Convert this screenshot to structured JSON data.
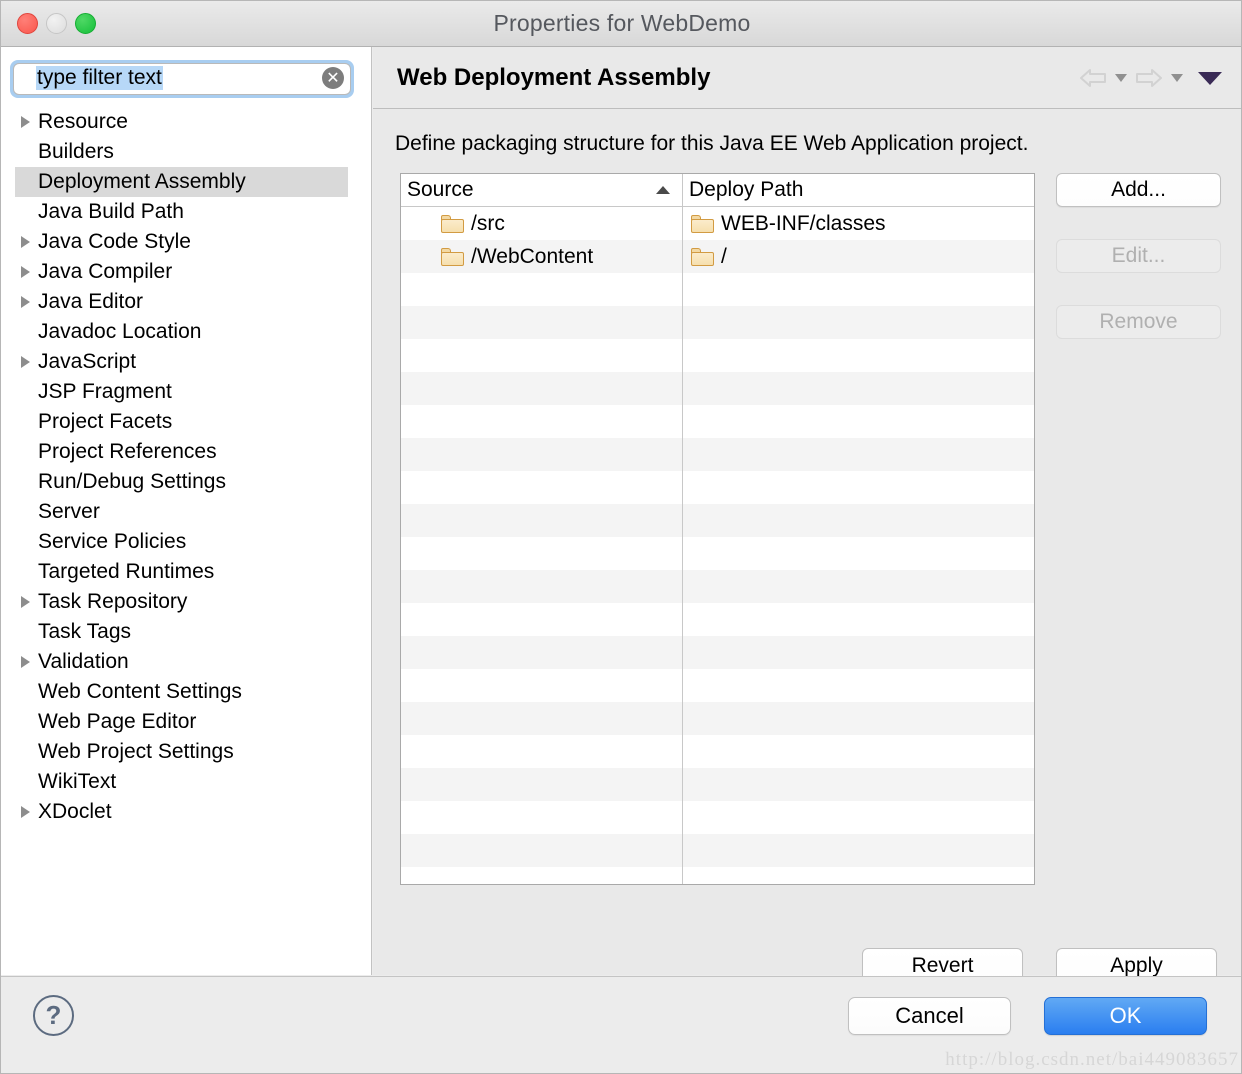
{
  "window": {
    "title": "Properties for WebDemo",
    "traffic_lights": [
      "close",
      "minimize",
      "maximize"
    ]
  },
  "sidebar": {
    "filter": {
      "value": "type filter text",
      "placeholder": "type filter text",
      "clear_glyph": "✕"
    },
    "items": [
      {
        "label": "Resource",
        "expandable": true,
        "selected": false
      },
      {
        "label": "Builders",
        "expandable": false,
        "selected": false
      },
      {
        "label": "Deployment Assembly",
        "expandable": false,
        "selected": true
      },
      {
        "label": "Java Build Path",
        "expandable": false,
        "selected": false
      },
      {
        "label": "Java Code Style",
        "expandable": true,
        "selected": false
      },
      {
        "label": "Java Compiler",
        "expandable": true,
        "selected": false
      },
      {
        "label": "Java Editor",
        "expandable": true,
        "selected": false
      },
      {
        "label": "Javadoc Location",
        "expandable": false,
        "selected": false
      },
      {
        "label": "JavaScript",
        "expandable": true,
        "selected": false
      },
      {
        "label": "JSP Fragment",
        "expandable": false,
        "selected": false
      },
      {
        "label": "Project Facets",
        "expandable": false,
        "selected": false
      },
      {
        "label": "Project References",
        "expandable": false,
        "selected": false
      },
      {
        "label": "Run/Debug Settings",
        "expandable": false,
        "selected": false
      },
      {
        "label": "Server",
        "expandable": false,
        "selected": false
      },
      {
        "label": "Service Policies",
        "expandable": false,
        "selected": false
      },
      {
        "label": "Targeted Runtimes",
        "expandable": false,
        "selected": false
      },
      {
        "label": "Task Repository",
        "expandable": true,
        "selected": false
      },
      {
        "label": "Task Tags",
        "expandable": false,
        "selected": false
      },
      {
        "label": "Validation",
        "expandable": true,
        "selected": false
      },
      {
        "label": "Web Content Settings",
        "expandable": false,
        "selected": false
      },
      {
        "label": "Web Page Editor",
        "expandable": false,
        "selected": false
      },
      {
        "label": "Web Project Settings",
        "expandable": false,
        "selected": false
      },
      {
        "label": "WikiText",
        "expandable": false,
        "selected": false
      },
      {
        "label": "XDoclet",
        "expandable": true,
        "selected": false
      }
    ]
  },
  "pane": {
    "title": "Web Deployment Assembly",
    "description": "Define packaging structure for this Java EE Web Application project.",
    "nav": {
      "back_icon": "back-arrow-icon",
      "back_menu_icon": "chevron-down-icon",
      "forward_icon": "forward-arrow-icon",
      "forward_menu_icon": "chevron-down-icon",
      "menu_icon": "view-menu-icon"
    },
    "table": {
      "columns": [
        {
          "label": "Source",
          "sort": "ascending"
        },
        {
          "label": "Deploy Path",
          "sort": "none"
        }
      ],
      "rows": [
        {
          "source": "/src",
          "deploy_path": "WEB-INF/classes"
        },
        {
          "source": "/WebContent",
          "deploy_path": "/"
        }
      ],
      "empty_row_count": 19
    },
    "side_buttons": [
      {
        "label": "Add...",
        "enabled": true
      },
      {
        "label": "Edit...",
        "enabled": false
      },
      {
        "label": "Remove",
        "enabled": false
      }
    ],
    "bottom_buttons": [
      {
        "label": "Revert",
        "enabled": true
      },
      {
        "label": "Apply",
        "enabled": true
      }
    ]
  },
  "footer": {
    "help_glyph": "?",
    "cancel_label": "Cancel",
    "ok_label": "OK",
    "watermark": "http://blog.csdn.net/bai449083657"
  },
  "colors": {
    "accent_blue": "#2a7ef0",
    "selection_gray": "#d9d9d9",
    "focus_ring": "#a8cdf0",
    "folder_orange": "#d29b42",
    "menu_caret": "#3a2b56"
  }
}
